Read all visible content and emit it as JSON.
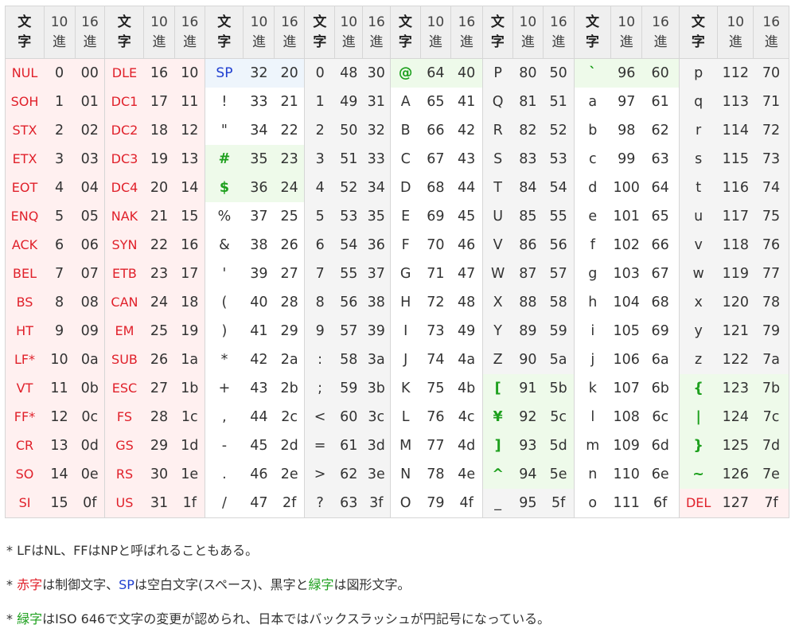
{
  "headers": {
    "char": "文\n字",
    "dec": "10\n進",
    "hex": "16\n進"
  },
  "groups": [
    {
      "name": "control-0",
      "rows": [
        [
          "NUL",
          "0",
          "00"
        ],
        [
          "SOH",
          "1",
          "01"
        ],
        [
          "STX",
          "2",
          "02"
        ],
        [
          "ETX",
          "3",
          "03"
        ],
        [
          "EOT",
          "4",
          "04"
        ],
        [
          "ENQ",
          "5",
          "05"
        ],
        [
          "ACK",
          "6",
          "06"
        ],
        [
          "BEL",
          "7",
          "07"
        ],
        [
          "BS",
          "8",
          "08"
        ],
        [
          "HT",
          "9",
          "09"
        ],
        [
          "LF*",
          "10",
          "0a"
        ],
        [
          "VT",
          "11",
          "0b"
        ],
        [
          "FF*",
          "12",
          "0c"
        ],
        [
          "CR",
          "13",
          "0d"
        ],
        [
          "SO",
          "14",
          "0e"
        ],
        [
          "SI",
          "15",
          "0f"
        ]
      ]
    },
    {
      "name": "control-1",
      "rows": [
        [
          "DLE",
          "16",
          "10"
        ],
        [
          "DC1",
          "17",
          "11"
        ],
        [
          "DC2",
          "18",
          "12"
        ],
        [
          "DC3",
          "19",
          "13"
        ],
        [
          "DC4",
          "20",
          "14"
        ],
        [
          "NAK",
          "21",
          "15"
        ],
        [
          "SYN",
          "22",
          "16"
        ],
        [
          "ETB",
          "23",
          "17"
        ],
        [
          "CAN",
          "24",
          "18"
        ],
        [
          "EM",
          "25",
          "19"
        ],
        [
          "SUB",
          "26",
          "1a"
        ],
        [
          "ESC",
          "27",
          "1b"
        ],
        [
          "FS",
          "28",
          "1c"
        ],
        [
          "GS",
          "29",
          "1d"
        ],
        [
          "RS",
          "30",
          "1e"
        ],
        [
          "US",
          "31",
          "1f"
        ]
      ]
    },
    {
      "name": "symbols",
      "rows": [
        [
          "SP",
          "32",
          "20"
        ],
        [
          "!",
          "33",
          "21"
        ],
        [
          "\"",
          "34",
          "22"
        ],
        [
          "#",
          "35",
          "23"
        ],
        [
          "$",
          "36",
          "24"
        ],
        [
          "%",
          "37",
          "25"
        ],
        [
          "&",
          "38",
          "26"
        ],
        [
          "'",
          "39",
          "27"
        ],
        [
          "(",
          "40",
          "28"
        ],
        [
          ")",
          "41",
          "29"
        ],
        [
          "*",
          "42",
          "2a"
        ],
        [
          "+",
          "43",
          "2b"
        ],
        [
          ",",
          "44",
          "2c"
        ],
        [
          "-",
          "45",
          "2d"
        ],
        [
          ".",
          "46",
          "2e"
        ],
        [
          "/",
          "47",
          "2f"
        ]
      ]
    },
    {
      "name": "digits",
      "rows": [
        [
          "0",
          "48",
          "30"
        ],
        [
          "1",
          "49",
          "31"
        ],
        [
          "2",
          "50",
          "32"
        ],
        [
          "3",
          "51",
          "33"
        ],
        [
          "4",
          "52",
          "34"
        ],
        [
          "5",
          "53",
          "35"
        ],
        [
          "6",
          "54",
          "36"
        ],
        [
          "7",
          "55",
          "37"
        ],
        [
          "8",
          "56",
          "38"
        ],
        [
          "9",
          "57",
          "39"
        ],
        [
          ":",
          "58",
          "3a"
        ],
        [
          ";",
          "59",
          "3b"
        ],
        [
          "<",
          "60",
          "3c"
        ],
        [
          "=",
          "61",
          "3d"
        ],
        [
          ">",
          "62",
          "3e"
        ],
        [
          "?",
          "63",
          "3f"
        ]
      ]
    },
    {
      "name": "upper-1",
      "rows": [
        [
          "@",
          "64",
          "40"
        ],
        [
          "A",
          "65",
          "41"
        ],
        [
          "B",
          "66",
          "42"
        ],
        [
          "C",
          "67",
          "43"
        ],
        [
          "D",
          "68",
          "44"
        ],
        [
          "E",
          "69",
          "45"
        ],
        [
          "F",
          "70",
          "46"
        ],
        [
          "G",
          "71",
          "47"
        ],
        [
          "H",
          "72",
          "48"
        ],
        [
          "I",
          "73",
          "49"
        ],
        [
          "J",
          "74",
          "4a"
        ],
        [
          "K",
          "75",
          "4b"
        ],
        [
          "L",
          "76",
          "4c"
        ],
        [
          "M",
          "77",
          "4d"
        ],
        [
          "N",
          "78",
          "4e"
        ],
        [
          "O",
          "79",
          "4f"
        ]
      ]
    },
    {
      "name": "upper-2",
      "rows": [
        [
          "P",
          "80",
          "50"
        ],
        [
          "Q",
          "81",
          "51"
        ],
        [
          "R",
          "82",
          "52"
        ],
        [
          "S",
          "83",
          "53"
        ],
        [
          "T",
          "84",
          "54"
        ],
        [
          "U",
          "85",
          "55"
        ],
        [
          "V",
          "86",
          "56"
        ],
        [
          "W",
          "87",
          "57"
        ],
        [
          "X",
          "88",
          "58"
        ],
        [
          "Y",
          "89",
          "59"
        ],
        [
          "Z",
          "90",
          "5a"
        ],
        [
          "[",
          "91",
          "5b"
        ],
        [
          "¥",
          "92",
          "5c"
        ],
        [
          "]",
          "93",
          "5d"
        ],
        [
          "^",
          "94",
          "5e"
        ],
        [
          "_",
          "95",
          "5f"
        ]
      ]
    },
    {
      "name": "lower-1",
      "rows": [
        [
          "`",
          "96",
          "60"
        ],
        [
          "a",
          "97",
          "61"
        ],
        [
          "b",
          "98",
          "62"
        ],
        [
          "c",
          "99",
          "63"
        ],
        [
          "d",
          "100",
          "64"
        ],
        [
          "e",
          "101",
          "65"
        ],
        [
          "f",
          "102",
          "66"
        ],
        [
          "g",
          "103",
          "67"
        ],
        [
          "h",
          "104",
          "68"
        ],
        [
          "i",
          "105",
          "69"
        ],
        [
          "j",
          "106",
          "6a"
        ],
        [
          "k",
          "107",
          "6b"
        ],
        [
          "l",
          "108",
          "6c"
        ],
        [
          "m",
          "109",
          "6d"
        ],
        [
          "n",
          "110",
          "6e"
        ],
        [
          "o",
          "111",
          "6f"
        ]
      ]
    },
    {
      "name": "lower-2",
      "rows": [
        [
          "p",
          "112",
          "70"
        ],
        [
          "q",
          "113",
          "71"
        ],
        [
          "r",
          "114",
          "72"
        ],
        [
          "s",
          "115",
          "73"
        ],
        [
          "t",
          "116",
          "74"
        ],
        [
          "u",
          "117",
          "75"
        ],
        [
          "v",
          "118",
          "76"
        ],
        [
          "w",
          "119",
          "77"
        ],
        [
          "x",
          "120",
          "78"
        ],
        [
          "y",
          "121",
          "79"
        ],
        [
          "z",
          "122",
          "7a"
        ],
        [
          "{",
          "123",
          "7b"
        ],
        [
          "|",
          "124",
          "7c"
        ],
        [
          "}",
          "125",
          "7d"
        ],
        [
          "~",
          "126",
          "7e"
        ],
        [
          "DEL",
          "127",
          "7f"
        ]
      ]
    }
  ],
  "control_codes": [
    0,
    1,
    2,
    3,
    4,
    5,
    6,
    7,
    8,
    9,
    10,
    11,
    12,
    13,
    14,
    15,
    16,
    17,
    18,
    19,
    20,
    21,
    22,
    23,
    24,
    25,
    26,
    27,
    28,
    29,
    30,
    31,
    127
  ],
  "space_codes": [
    32
  ],
  "iso_variant_codes": [
    35,
    36,
    64,
    91,
    92,
    93,
    94,
    96,
    123,
    124,
    125,
    126
  ],
  "colors": {
    "control_text": "#e0202a",
    "control_bg": "#fff0f0",
    "space_text": "#1f3fd0",
    "space_bg": "#eef5fc",
    "iso_text": "#1ea01e",
    "iso_bg": "#eefaea",
    "header_bg": "#efefef",
    "alt_bg": "#f4f4f4"
  },
  "notes": {
    "n1": "* LFはNL、FFはNPと呼ばれることもある。",
    "n2_prefix": "* ",
    "n2_red": "赤字",
    "n2_mid1": "は制御文字、",
    "n2_sp": "SP",
    "n2_mid2": "は空白文字(スペース)、黒字と",
    "n2_green": "緑字",
    "n2_suffix": "は図形文字。",
    "n3_prefix": "* ",
    "n3_green": "緑字",
    "n3_suffix": "はISO 646で文字の変更が認められ、日本ではバックスラッシュが円記号になっている。"
  }
}
